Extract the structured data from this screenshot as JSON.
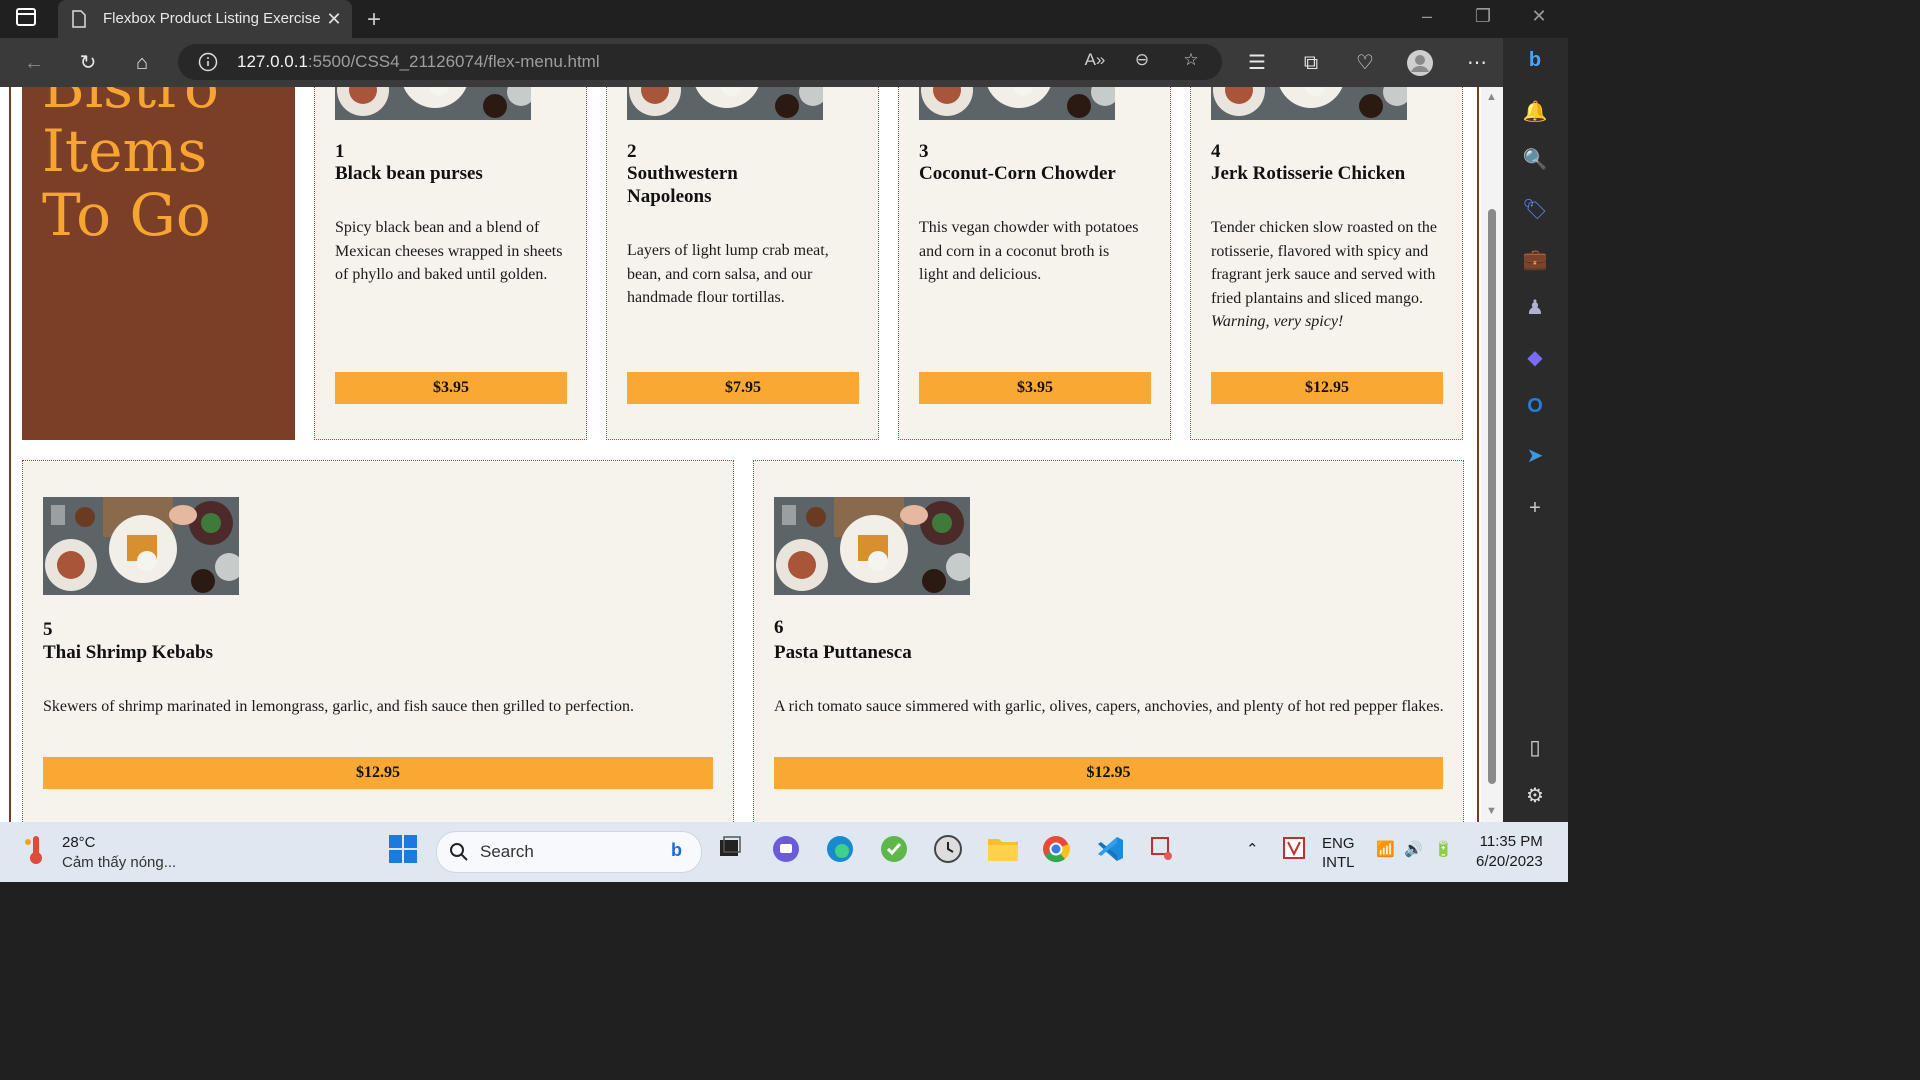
{
  "browser": {
    "tab_title": "Flexbox Product Listing Exercise",
    "url_host": "127.0.0.1",
    "url_rest": ":5500/CSS4_21126074/flex-menu.html"
  },
  "page": {
    "heading_lines": [
      "Bistro",
      "Items",
      "To Go"
    ],
    "items": [
      {
        "num": "1",
        "name": "Black bean purses",
        "desc": "Spicy black bean and a blend of Mexican cheeses wrapped in sheets of phyllo and baked until golden.",
        "desc_em": "",
        "price": "$3.95"
      },
      {
        "num": "2",
        "name": "Southwestern Napoleons",
        "desc": "Layers of light lump crab meat, bean, and corn salsa, and our handmade flour tortillas.",
        "desc_em": "",
        "price": "$7.95"
      },
      {
        "num": "3",
        "name": "Coconut-Corn Chowder",
        "desc": "This vegan chowder with potatoes and corn in a coconut broth is light and delicious.",
        "desc_em": "",
        "price": "$3.95"
      },
      {
        "num": "4",
        "name": "Jerk Rotisserie Chicken",
        "desc": "Tender chicken slow roasted on the rotisserie, flavored with spicy and fragrant jerk sauce and served with fried plantains and sliced mango. ",
        "desc_em": "Warning, very spicy!",
        "price": "$12.95"
      },
      {
        "num": "5",
        "name": "Thai Shrimp Kebabs",
        "desc": "Skewers of shrimp marinated in lemongrass, garlic, and fish sauce then grilled to perfection.",
        "desc_em": "",
        "price": "$12.95"
      },
      {
        "num": "6",
        "name": "Pasta Puttanesca",
        "desc": "A rich tomato sauce simmered with garlic, olives, capers, anchovies, and plenty of hot red pepper flakes.",
        "desc_em": "",
        "price": "$12.95"
      }
    ]
  },
  "taskbar": {
    "weather_temp": "28°C",
    "weather_desc": "Cảm thấy nóng...",
    "search_label": "Search",
    "lang_top": "ENG",
    "lang_bottom": "INTL",
    "time": "11:35 PM",
    "date": "6/20/2023"
  },
  "colors": {
    "accent": "#f9a834",
    "heading_bg": "#7b3f27",
    "heading_text": "#f6a531",
    "card_bg": "#f6f2ec"
  }
}
